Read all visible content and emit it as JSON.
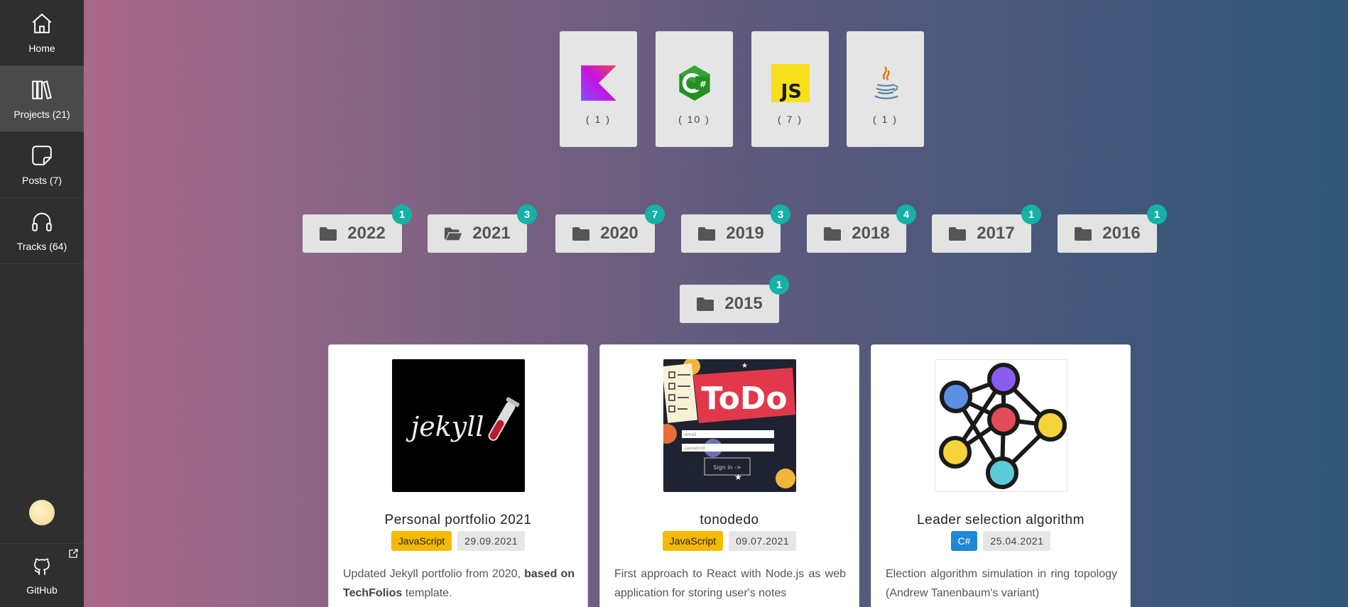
{
  "sidebar": {
    "items": [
      {
        "label": "Home",
        "icon": "home-icon"
      },
      {
        "label": "Projects (21)",
        "icon": "library-icon"
      },
      {
        "label": "Posts (7)",
        "icon": "sticky-note-icon"
      },
      {
        "label": "Tracks (64)",
        "icon": "headphones-icon"
      }
    ],
    "github_label": "GitHub"
  },
  "languages": [
    {
      "name": "Kotlin",
      "count": "( 1 )"
    },
    {
      "name": "C#",
      "count": "( 10 )"
    },
    {
      "name": "JavaScript",
      "count": "( 7 )"
    },
    {
      "name": "Java",
      "count": "( 1 )"
    }
  ],
  "years": [
    {
      "label": "2022",
      "count": "1"
    },
    {
      "label": "2021",
      "count": "3"
    },
    {
      "label": "2020",
      "count": "7"
    },
    {
      "label": "2019",
      "count": "3"
    },
    {
      "label": "2018",
      "count": "4"
    },
    {
      "label": "2017",
      "count": "1"
    },
    {
      "label": "2016",
      "count": "1"
    },
    {
      "label": "2015",
      "count": "1"
    }
  ],
  "projects": [
    {
      "title": "Personal portfolio 2021",
      "lang": "JavaScript",
      "date": "29.09.2021",
      "desc_pre": "Updated Jekyll portfolio from 2020, ",
      "desc_bold": "based on TechFolios",
      "desc_post": " template.",
      "image_text": "jekyll"
    },
    {
      "title": "tonodedo",
      "lang": "JavaScript",
      "date": "09.07.2021",
      "desc": "First approach to React with Node.js as web application for storing user's notes",
      "image_text": "ToDo",
      "image_field1": "email",
      "image_field2": "password",
      "image_button": "Sign in ->"
    },
    {
      "title": "Leader selection algorithm",
      "lang": "C#",
      "date": "25.04.2021",
      "desc": "Election algorithm simulation in ring topology (Andrew Tanenbaum's variant)"
    }
  ],
  "colors": {
    "sidebar_bg": "#2f2f2f",
    "badge": "#14b1a6",
    "tag_js": "#f5b900",
    "tag_cs": "#1e88d6"
  }
}
